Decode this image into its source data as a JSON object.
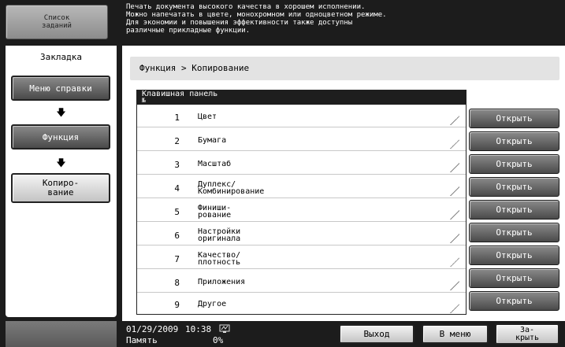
{
  "header": {
    "job_list_label": "Список\nзаданий",
    "message": "Печать документа высокого качества в хорошем исполнении.\nМожно напечатать в цвете, монохромном или одноцветном режиме.\nДля экономии и повышения эффективности также доступны\nразличные прикладные функции."
  },
  "sidebar": {
    "tab_label": "Закладка",
    "items": [
      {
        "label": "Меню справки"
      },
      {
        "label": "Функция"
      },
      {
        "label": "Копиро-\nвание"
      }
    ]
  },
  "breadcrumb": {
    "text": "Функция > Копирование"
  },
  "list": {
    "header": "Клавишная панель",
    "header_sub": "№",
    "rows": [
      {
        "num": "1",
        "label": "Цвет"
      },
      {
        "num": "2",
        "label": "Бумага"
      },
      {
        "num": "3",
        "label": "Масштаб"
      },
      {
        "num": "4",
        "label": "Дуплекс/\nКомбинирование"
      },
      {
        "num": "5",
        "label": "Финиши-\nрование"
      },
      {
        "num": "6",
        "label": "Настройки\nоригинала"
      },
      {
        "num": "7",
        "label": "Качество/\nплотность"
      },
      {
        "num": "8",
        "label": "Приложения"
      },
      {
        "num": "9",
        "label": "Другое"
      }
    ],
    "open_label": "Открыть"
  },
  "footer": {
    "date": "01/29/2009",
    "time": "10:38",
    "memory_label": "Память",
    "memory_value": "0%",
    "exit_label": "Выход",
    "menu_label": "В меню",
    "close_label": "За-\nкрыть"
  }
}
